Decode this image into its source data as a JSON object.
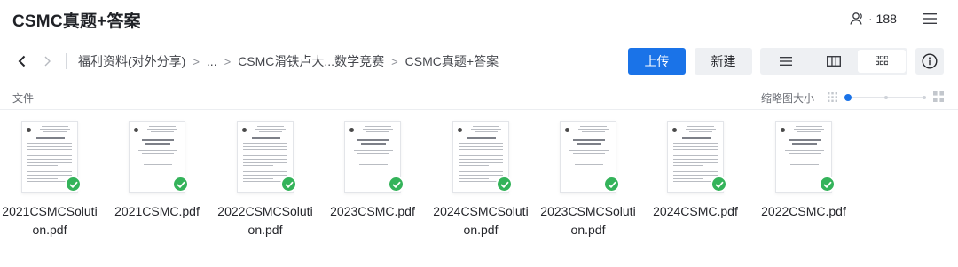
{
  "header": {
    "title": "CSMC真题+答案",
    "members_count": "· 188",
    "members_icon": "members-icon",
    "menu_icon": "hamburger-menu-icon"
  },
  "toolbar": {
    "back_icon": "chevron-left-icon",
    "forward_icon": "chevron-right-icon",
    "breadcrumb": [
      "福利资料(对外分享)",
      "...",
      "CSMC滑铁卢大...数学竞赛",
      "CSMC真题+答案"
    ],
    "upload_label": "上传",
    "new_label": "新建",
    "views": [
      {
        "icon": "list-view-icon",
        "active": false
      },
      {
        "icon": "column-view-icon",
        "active": false
      },
      {
        "icon": "thumbnail-view-icon",
        "active": true
      }
    ],
    "info_icon": "info-icon",
    "accent_color": "#1a73e8"
  },
  "subheader": {
    "column_label": "文件",
    "thumbnail_size_label": "缩略图大小",
    "thumbnail_size_level": 0.0
  },
  "files": [
    {
      "name": "2021CSMCSolution.pdf",
      "synced": true
    },
    {
      "name": "2021CSMC.pdf",
      "synced": true
    },
    {
      "name": "2022CSMCSolution.pdf",
      "synced": true
    },
    {
      "name": "2023CSMC.pdf",
      "synced": true
    },
    {
      "name": "2024CSMCSolution.pdf",
      "synced": true
    },
    {
      "name": "2023CSMCSolution.pdf",
      "synced": true
    },
    {
      "name": "2024CSMC.pdf",
      "synced": true
    },
    {
      "name": "2022CSMC.pdf",
      "synced": true
    }
  ],
  "sync_color": "#34b35a"
}
